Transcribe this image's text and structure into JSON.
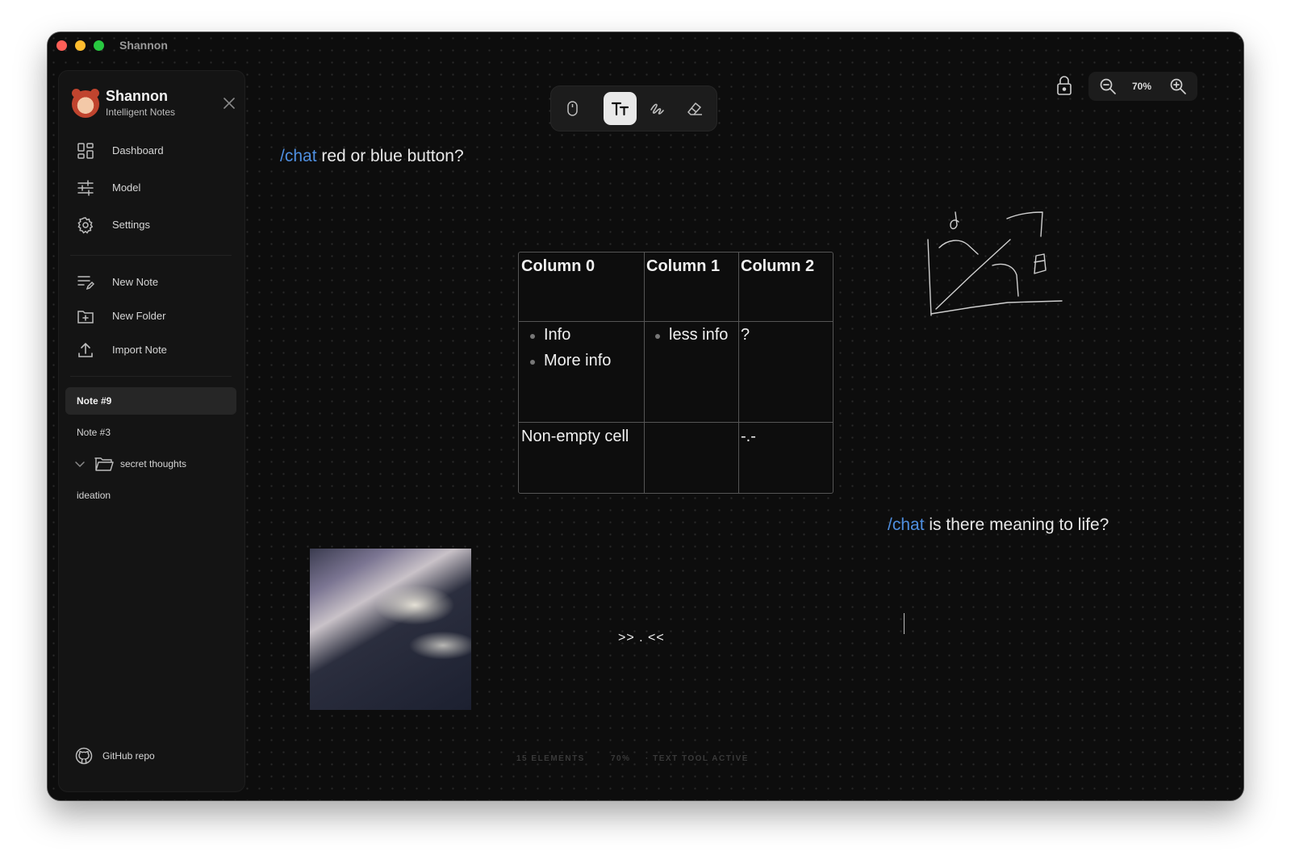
{
  "window": {
    "title": "Shannon"
  },
  "sidebar": {
    "brand_name": "Shannon",
    "brand_subtitle": "Intelligent Notes",
    "nav": [
      {
        "label": "Dashboard",
        "icon": "dashboard-icon"
      },
      {
        "label": "Model",
        "icon": "sliders-icon"
      },
      {
        "label": "Settings",
        "icon": "gear-icon"
      }
    ],
    "actions": [
      {
        "label": "New Note",
        "icon": "new-note-icon"
      },
      {
        "label": "New Folder",
        "icon": "new-folder-icon"
      },
      {
        "label": "Import Note",
        "icon": "upload-icon"
      }
    ],
    "notes": [
      {
        "label": "Note #9",
        "active": true
      },
      {
        "label": "Note #3",
        "active": false
      }
    ],
    "folder": {
      "label": "secret thoughts",
      "expanded": true
    },
    "folder_notes": [
      {
        "label": "ideation"
      }
    ],
    "github_label": "GitHub repo"
  },
  "toolbar": {
    "tools": [
      {
        "name": "select",
        "icon": "mouse-icon",
        "active": false
      },
      {
        "name": "text",
        "icon": "text-icon",
        "active": true
      },
      {
        "name": "draw",
        "icon": "scribble-icon",
        "active": false
      },
      {
        "name": "eraser",
        "icon": "eraser-icon",
        "active": false
      }
    ]
  },
  "zoom": {
    "level": "70%"
  },
  "canvas": {
    "chat1": {
      "command": "/chat",
      "text": " red or blue button?"
    },
    "chat2": {
      "command": "/chat",
      "text": " is there meaning to life?"
    },
    "table": {
      "headers": [
        "Column 0",
        "Column 1",
        "Column 2"
      ],
      "row1": {
        "c0": [
          "Info",
          "More info"
        ],
        "c1": [
          "less info"
        ],
        "c2": "?"
      },
      "row2": {
        "c0": "Non-empty cell",
        "c1": "",
        "c2": "-.-"
      }
    },
    "emote": ">> . <<"
  },
  "status": {
    "elements": "15 ELEMENTS",
    "zoom": "70%",
    "tool": "· TEXT TOOL ACTIVE"
  },
  "colors": {
    "accent": "#4f8fe0",
    "background": "#0d0d0d",
    "sidebar": "#141414"
  }
}
